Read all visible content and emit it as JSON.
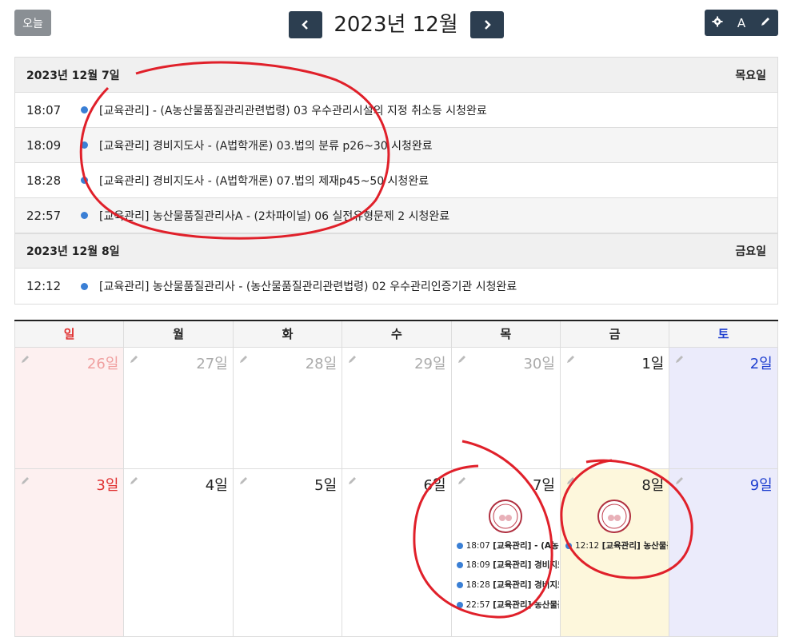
{
  "header": {
    "today_label": "오늘",
    "month_title": "2023년 12월",
    "prev_icon": "chevron-left-icon",
    "next_icon": "chevron-right-icon",
    "tools": {
      "settings_icon": "gear-icon",
      "font_label": "A",
      "edit_icon": "pencil-icon"
    }
  },
  "day_groups": [
    {
      "date": "2023년 12월 7일",
      "weekday": "목요일",
      "events": [
        {
          "time": "18:07",
          "text": "[교육관리] - (A농산물품질관리관련법령) 03 우수관리시설의 지정 취소등 시청완료"
        },
        {
          "time": "18:09",
          "text": "[교육관리] 경비지도사 - (A법학개론) 03.법의 분류 p26~30 시청완료"
        },
        {
          "time": "18:28",
          "text": "[교육관리] 경비지도사 - (A법학개론) 07.법의 제재p45~50 시청완료"
        },
        {
          "time": "22:57",
          "text": "[교육관리] 농산물품질관리사A - (2차파이널) 06 실전유형문제 2 시청완료"
        }
      ]
    },
    {
      "date": "2023년 12월 8일",
      "weekday": "금요일",
      "events": [
        {
          "time": "12:12",
          "text": "[교육관리] 농산물품질관리사 - (농산물품질관리관련법령) 02 우수관리인증기관 시청완료"
        }
      ]
    }
  ],
  "calendar": {
    "weekdays": [
      "일",
      "월",
      "화",
      "수",
      "목",
      "금",
      "토"
    ],
    "weekday_colors": [
      "#e03030",
      "#222222",
      "#222222",
      "#222222",
      "#222222",
      "#222222",
      "#2040d0"
    ],
    "weeks": [
      [
        "26일",
        "27일",
        "28일",
        "29일",
        "30일",
        "1일",
        "2일"
      ],
      [
        "3일",
        "4일",
        "5일",
        "6일",
        "7일",
        "8일",
        "9일"
      ]
    ],
    "thu_events": [
      {
        "time": "18:07",
        "text": "[교육관리] - (A농"
      },
      {
        "time": "18:09",
        "text": "[교육관리] 경비지도"
      },
      {
        "time": "18:28",
        "text": "[교육관리] 경비지도"
      },
      {
        "time": "22:57",
        "text": "[교육관리] 농산물품"
      }
    ],
    "fri_events": [
      {
        "time": "12:12",
        "text": "[교육관리] 농산물품"
      }
    ]
  },
  "colors": {
    "accent": "#2c3e50",
    "dot": "#3a7fd5",
    "annotation": "#e0202a",
    "today_bg": "#fdf7dc"
  }
}
